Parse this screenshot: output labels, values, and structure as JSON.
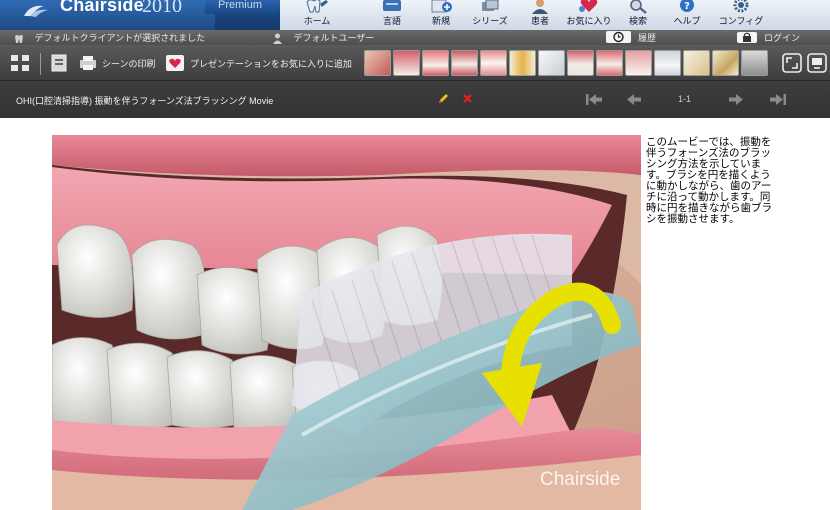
{
  "header": {
    "brand": "Chairside",
    "year": "2010",
    "edition": "Premium",
    "nav": [
      {
        "id": "home",
        "label": "ホーム",
        "icon": "tooth-home-icon"
      },
      {
        "id": "language",
        "label": "言語",
        "icon": "language-icon"
      },
      {
        "id": "new",
        "label": "新規",
        "icon": "new-icon"
      },
      {
        "id": "series",
        "label": "シリーズ",
        "icon": "series-icon"
      },
      {
        "id": "patient",
        "label": "患者",
        "icon": "patient-icon"
      },
      {
        "id": "favorites",
        "label": "お気に入り",
        "icon": "favorites-heart-icon"
      },
      {
        "id": "search",
        "label": "検索",
        "icon": "search-icon"
      },
      {
        "id": "help",
        "label": "ヘルプ",
        "icon": "help-icon"
      },
      {
        "id": "config",
        "label": "コンフィグ",
        "icon": "config-gear-icon"
      }
    ]
  },
  "status_bar": {
    "client": "デフォルトクライアントが選択されました",
    "user": "デフォルトユーザー",
    "history": "履歴",
    "login": "ログイン"
  },
  "toolbar": {
    "print_scene": "シーンの印刷",
    "add_presentation": "プレゼンテーションをお気に入りに追加"
  },
  "title_bar": {
    "movie_title": "OHI(口腔清掃指導) 振動を伴うフォーンズ法ブラッシング Movie",
    "page_indicator": "1-1"
  },
  "content": {
    "description": "このムービーでは、振動を伴うフォーンズ法のブラッシング方法を示しています。ブラシを円を描くように動かしながら、歯のアーチに沿って動かします。同時に円を描きながら歯ブラシを振動させます。",
    "watermark": "Chairside"
  },
  "colors": {
    "header_blue": "#1d4a86",
    "toolbar_gray": "#4a4a4a",
    "edit_pencil": "#f0c020",
    "delete_x": "#e02020",
    "arrow_yellow": "#e8e000"
  }
}
